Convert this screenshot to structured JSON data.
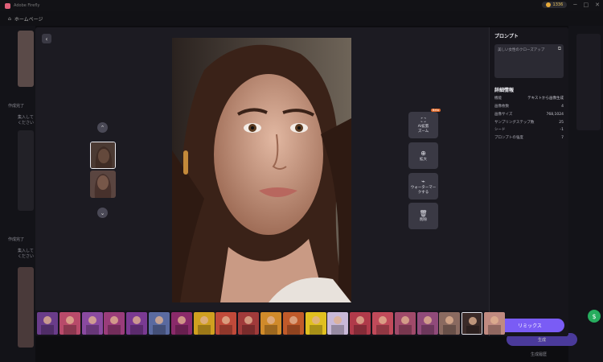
{
  "app": {
    "title": "Adobe Firefly",
    "credits": "1336"
  },
  "topbar": {
    "home_label": "ホームページ"
  },
  "background": {
    "section_a": "作成完了",
    "section_b": "作成完了",
    "sub_a": "集入してください",
    "sub_b": "集入してください",
    "generate_button": "生成",
    "footer_note": "生成履歴"
  },
  "modal": {
    "tools": {
      "ai_expand": "AI拡張\nズーム",
      "ai_expand_badge": "Beta",
      "zoom": "拡大",
      "watermark": "ウォーターマー\nクする",
      "delete": "削除"
    },
    "panel": {
      "prompt_heading": "プロンプト",
      "prompt_text": "美しい女性のクローズアップ",
      "detail_heading": "詳細情報",
      "details": [
        {
          "label": "機能",
          "value": "テキストから画像生成"
        },
        {
          "label": "画像枚数",
          "value": "4"
        },
        {
          "label": "画像サイズ",
          "value": "768,1024"
        },
        {
          "label": "サンプリングステップ数",
          "value": "25"
        },
        {
          "label": "シード",
          "value": "-1"
        },
        {
          "label": "プロンプトの強度",
          "value": "7"
        }
      ],
      "remix_button": "リミックス"
    }
  },
  "icons": [
    "back-icon",
    "chevron-up-icon",
    "chevron-down-icon",
    "expand-icon",
    "zoom-in-icon",
    "watermark-icon",
    "trash-icon",
    "copy-icon",
    "support-icon"
  ]
}
